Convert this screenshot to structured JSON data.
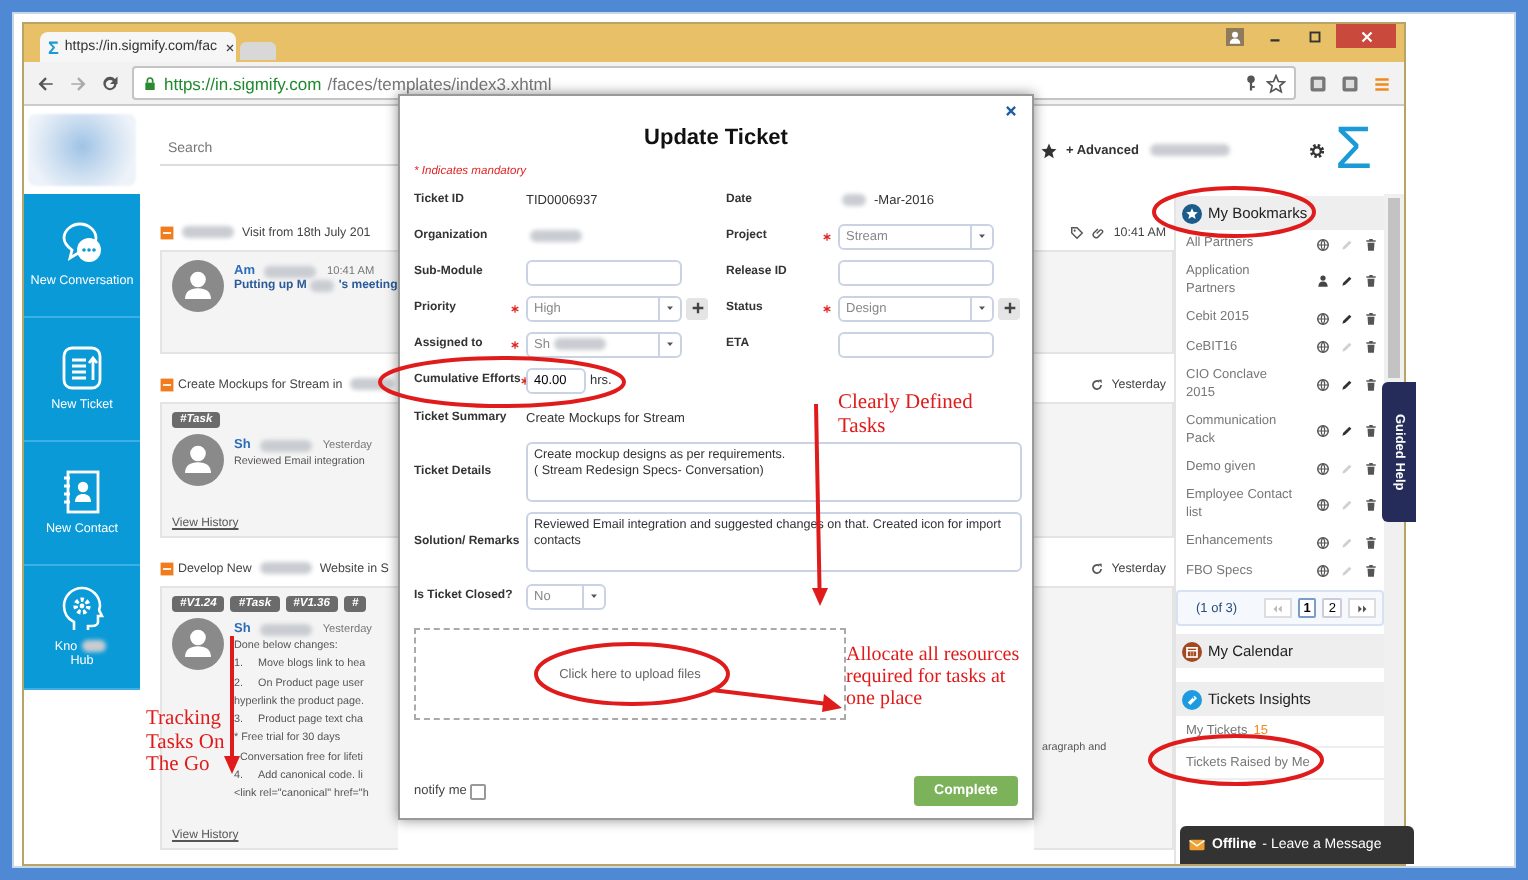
{
  "browser": {
    "favicon": "Σ",
    "tab_title": "https://in.sigmify.com/fac",
    "url_host": "https://in.sigmify.com",
    "url_path": "/faces/templates/index3.xhtml"
  },
  "header": {
    "search_placeholder": "Search",
    "advanced": "+ Advanced",
    "logo": "Σ"
  },
  "nav": [
    {
      "kind": "chat",
      "label": "New Conversation"
    },
    {
      "kind": "ticket",
      "label": "New Ticket"
    },
    {
      "kind": "contact",
      "label": "New Contact"
    },
    {
      "kind": "knowledge",
      "label": "Kno",
      "label_end": "Hub"
    }
  ],
  "feed": [
    {
      "title": [
        {
          "kind": "blur"
        },
        {
          "kind": "text",
          "text": "Visit from 18th July 201"
        }
      ],
      "time": "10:41 AM",
      "author": "Am",
      "post_time": "10:41 AM",
      "subject": [
        {
          "kind": "text",
          "text": "Putting up M"
        },
        {
          "kind": "blur"
        },
        {
          "kind": "text",
          "text": "'s meeting"
        }
      ]
    },
    {
      "title": [
        {
          "kind": "text",
          "text": "Create Mockups for Stream in"
        },
        {
          "kind": "blur"
        }
      ],
      "time": "Yesterday",
      "tags": [
        "#Task"
      ],
      "author": "Sh",
      "post_time": "Yesterday",
      "lines": [
        {
          "text": "Reviewed Email integration"
        }
      ],
      "history": "View History"
    },
    {
      "title": [
        {
          "kind": "text",
          "text": "Develop New"
        },
        {
          "kind": "blur"
        },
        {
          "kind": "text",
          "text": "Website in S"
        }
      ],
      "time": "Yesterday",
      "tags": [
        "#V1.24",
        "#Task",
        "#V1.36",
        "#"
      ],
      "author": "Sh",
      "post_time": "Yesterday",
      "lines": [
        {
          "text": "Done below changes:"
        },
        {
          "marker": "1.",
          "text": "Move blogs link to hea"
        },
        {
          "marker": "2.",
          "text": "On Product page user"
        },
        {
          "text": "hyperlink the product page."
        },
        {
          "marker": "3.",
          "text": "Product page text cha"
        },
        {
          "text": "* Free trial for 30 days"
        },
        {
          "text": "  Conversation free for lifeti"
        },
        {
          "marker": "4.",
          "text": "Add canonical code. li"
        },
        {
          "text": "<link rel=\"canonical\" href=\"h"
        }
      ],
      "right_text": "aragraph and",
      "history": "View History"
    }
  ],
  "modal": {
    "title": "Update Ticket",
    "mandatory_note": "* Indicates mandatory",
    "grid_fields": [
      {
        "label": "Ticket ID",
        "kind": "text",
        "value": "TID0006937",
        "required": false
      },
      {
        "label": "Date",
        "kind": "text",
        "value": "-Mar-2016",
        "blur_prefix": true,
        "required": false
      },
      {
        "label": "Organization",
        "kind": "blur",
        "required": false
      },
      {
        "label": "Project",
        "kind": "select",
        "value": "Stream",
        "required": true
      },
      {
        "label": "Sub-Module",
        "kind": "input",
        "required": false
      },
      {
        "label": "Release ID",
        "kind": "input",
        "required": false
      },
      {
        "label": "Priority",
        "kind": "select",
        "value": "High",
        "plus": true,
        "required": true
      },
      {
        "label": "Status",
        "kind": "select",
        "value": "Design",
        "plus": true,
        "required": true
      },
      {
        "label": "Assigned to",
        "kind": "select",
        "value": "Sh",
        "blur_suffix": true,
        "required": true
      },
      {
        "label": "ETA",
        "kind": "input",
        "required": false
      }
    ],
    "fields": [
      {
        "label": "Cumulative Efforts",
        "kind": "input",
        "value": "40.00",
        "unit": "hrs.",
        "required": true
      },
      {
        "label": "Ticket Summary",
        "kind": "text",
        "value": "Create Mockups for Stream",
        "required": false
      },
      {
        "label": "Ticket Details",
        "kind": "textarea",
        "value": "Create mockup designs as per requirements.\n( Stream Redesign Specs- Conversation)",
        "required": false
      },
      {
        "label": "Solution/ Remarks",
        "kind": "textarea",
        "value": "Reviewed Email integration and suggested changes on that. Created icon for import contacts",
        "required": false
      },
      {
        "label": "Is Ticket Closed?",
        "kind": "select",
        "value": "No",
        "required": false
      }
    ],
    "upload": "Click here to upload files",
    "notify": {
      "label": "notify me",
      "checked": false
    },
    "submit": "Complete"
  },
  "bookmarks": {
    "title": "My Bookmarks",
    "items": [
      {
        "name": "All Partners",
        "kind": "globe",
        "editable": false
      },
      {
        "name": "Application Partners",
        "kind": "person",
        "editable": true
      },
      {
        "name": "Cebit 2015",
        "kind": "globe",
        "editable": true
      },
      {
        "name": "CeBIT16",
        "kind": "globe",
        "editable": false
      },
      {
        "name": "CIO Conclave 2015",
        "kind": "globe",
        "editable": true
      },
      {
        "name": "Communication Pack",
        "kind": "globe",
        "editable": true
      },
      {
        "name": "Demo given",
        "kind": "globe",
        "editable": false
      },
      {
        "name": "Employee Contact list",
        "kind": "globe",
        "editable": false
      },
      {
        "name": "Enhancements",
        "kind": "globe",
        "editable": false
      },
      {
        "name": "FBO Specs",
        "kind": "globe",
        "editable": false
      }
    ],
    "pager": {
      "label": "(1 of 3)",
      "pages": [
        {
          "label": "1",
          "selected": true
        },
        {
          "label": "2",
          "selected": false
        }
      ]
    }
  },
  "calendar": {
    "title": "My Calendar"
  },
  "insights": {
    "title": "Tickets Insights",
    "items": [
      {
        "label": "My Tickets",
        "count": "15"
      },
      {
        "label": "Tickets Raised by Me"
      }
    ]
  },
  "guided_help": "Guided Help",
  "chat": {
    "status": "Offline",
    "message": "- Leave a Message"
  },
  "annotations": [
    {
      "text": "Clearly Defined Tasks"
    },
    {
      "text": "Allocate all resources required for tasks at one place"
    },
    {
      "text": "Tracking Tasks On The Go"
    }
  ]
}
